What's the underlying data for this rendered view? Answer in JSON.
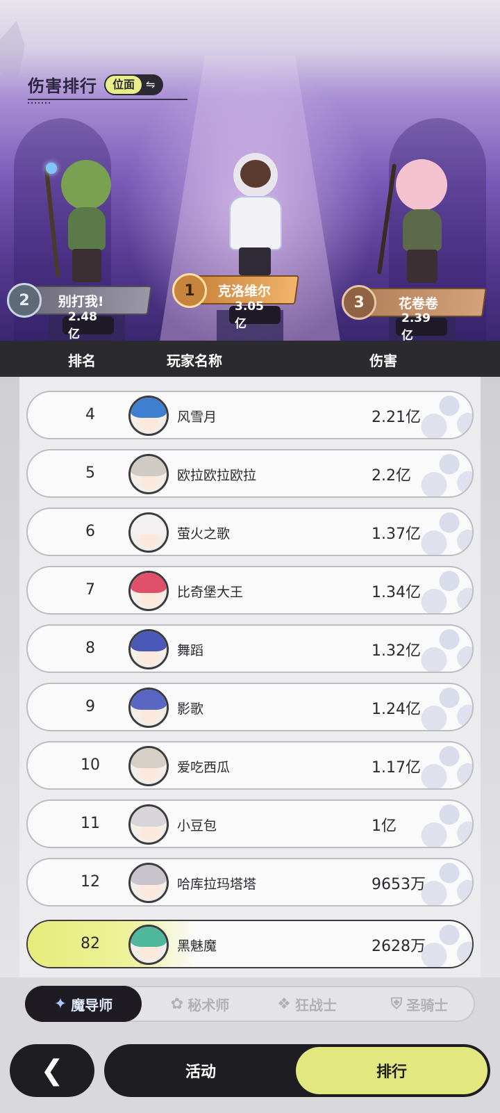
{
  "header": {
    "title": "伤害排行",
    "scope_label": "位面",
    "swap_icon": "swap-icon"
  },
  "podium": {
    "first": {
      "rank": "1",
      "name": "克洛维尔",
      "damage": "3.05亿"
    },
    "second": {
      "rank": "2",
      "name": "别打我!",
      "damage": "2.48亿"
    },
    "third": {
      "rank": "3",
      "name": "花卷卷",
      "damage": "2.39亿"
    }
  },
  "table": {
    "columns": {
      "rank": "排名",
      "name": "玩家名称",
      "damage": "伤害"
    },
    "rows": [
      {
        "rank": "4",
        "name": "风雪月",
        "damage": "2.21亿",
        "hair": "#3f7fcf"
      },
      {
        "rank": "5",
        "name": "欧拉欧拉欧拉",
        "damage": "2.2亿",
        "hair": "#cfcac4"
      },
      {
        "rank": "6",
        "name": "萤火之歌",
        "damage": "1.37亿",
        "hair": "#f2f0f0"
      },
      {
        "rank": "7",
        "name": "比奇堡大王",
        "damage": "1.34亿",
        "hair": "#e0506a"
      },
      {
        "rank": "8",
        "name": "舞蹈",
        "damage": "1.32亿",
        "hair": "#4a58b8"
      },
      {
        "rank": "9",
        "name": "影歌",
        "damage": "1.24亿",
        "hair": "#5a66c4"
      },
      {
        "rank": "10",
        "name": "爱吃西瓜",
        "damage": "1.17亿",
        "hair": "#d6cfc8"
      },
      {
        "rank": "11",
        "name": "小豆包",
        "damage": "1亿",
        "hair": "#d9d4d9"
      },
      {
        "rank": "12",
        "name": "哈库拉玛塔塔",
        "damage": "9653万",
        "hair": "#c9c4cc"
      }
    ],
    "self_row": {
      "rank": "82",
      "name": "黑魅魔",
      "damage": "2628万",
      "hair": "#4fb79a"
    }
  },
  "class_tabs": [
    {
      "label": "魔导师",
      "icon": "mage-icon",
      "active": true
    },
    {
      "label": "秘术师",
      "icon": "arcanist-icon",
      "active": false
    },
    {
      "label": "狂战士",
      "icon": "berserker-icon",
      "active": false
    },
    {
      "label": "圣骑士",
      "icon": "paladin-icon",
      "active": false
    }
  ],
  "bottom_nav": {
    "back_icon": "back-arrow-icon",
    "activity": "活动",
    "ranking": "排行",
    "active": "ranking"
  },
  "colors": {
    "accent_yellow": "#e2e87f",
    "dark": "#1e1d22",
    "gold": "#e3a35a"
  }
}
